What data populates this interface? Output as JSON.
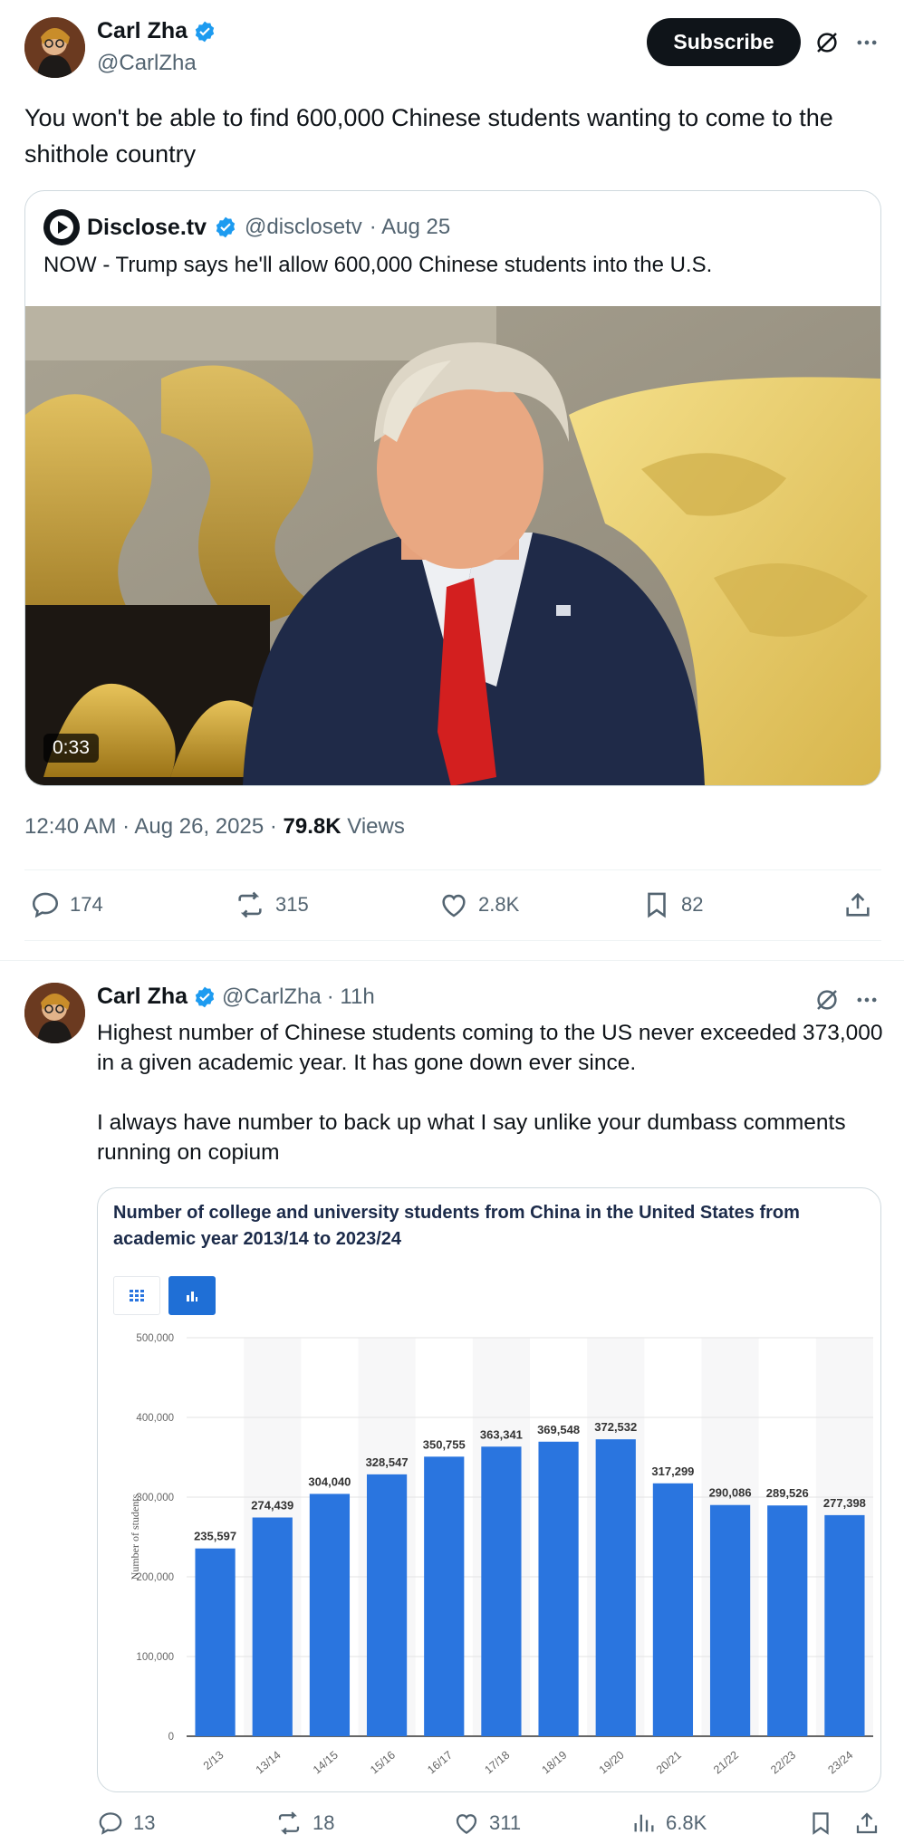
{
  "main_tweet": {
    "author_name": "Carl Zha",
    "author_handle": "@CarlZha",
    "subscribe_label": "Subscribe",
    "text": "You won't be able to find 600,000 Chinese students wanting to come to the shithole country",
    "quoted": {
      "author_name": "Disclose.tv",
      "author_handle": "@disclosetv",
      "date": "· Aug 25",
      "text": "NOW - Trump says he'll allow 600,000 Chinese students into the U.S.",
      "video_duration": "0:33"
    },
    "timestamp": "12:40 AM · Aug 26, 2025 · ",
    "views_count": "79.8K",
    "views_label": "Views",
    "actions": {
      "replies": "174",
      "reposts": "315",
      "likes": "2.8K",
      "bookmarks": "82"
    }
  },
  "reply_tweet": {
    "author_name": "Carl Zha",
    "author_handle": "@CarlZha",
    "time": "· 11h",
    "text_line1": "Highest number of Chinese students coming to the US never exceeded 373,000 in a given academic year. It has gone down ever since.",
    "text_line2": "I always have number to back up what I say unlike your dumbass comments running on copium",
    "actions": {
      "replies": "13",
      "reposts": "18",
      "likes": "311",
      "views": "6.8K"
    }
  },
  "colors": {
    "brand_blue": "#1d9bf0",
    "bar_blue": "#2a75df",
    "dark": "#0f1419"
  },
  "icons": [
    "verified-badge-icon",
    "grok-icon",
    "more-icon",
    "reply-icon",
    "repost-icon",
    "like-icon",
    "bookmark-icon",
    "share-icon",
    "views-icon",
    "table-view-icon",
    "chart-view-icon",
    "play-logo-icon"
  ],
  "chart_data": {
    "type": "bar",
    "title": "Number of college and university students from China in the United States from academic year 2013/14 to 2023/24",
    "ylabel": "Number of students",
    "xlabel": "",
    "ylim": [
      0,
      500000
    ],
    "yticks": [
      "0",
      "100,000",
      "200,000",
      "300,000",
      "400,000",
      "500,000"
    ],
    "categories": [
      "2012/13",
      "2013/14",
      "2014/15",
      "2015/16",
      "2016/17",
      "2017/18",
      "2018/19",
      "2019/20",
      "2020/21",
      "2021/22",
      "2022/23",
      "2023/24"
    ],
    "tick_labels_visible": [
      "2/13",
      "13/14",
      "14/15",
      "15/16",
      "16/17",
      "17/18",
      "18/19",
      "19/20",
      "20/21",
      "21/22",
      "22/23",
      "23/24"
    ],
    "values": [
      235597,
      274439,
      304040,
      328547,
      350755,
      363341,
      369548,
      372532,
      317299,
      290086,
      289526,
      277398
    ],
    "value_labels": [
      "235,597",
      "274,439",
      "304,040",
      "328,547",
      "350,755",
      "363,341",
      "369,548",
      "372,532",
      "317,299",
      "290,086",
      "289,526",
      "277,398"
    ],
    "grid": true
  }
}
